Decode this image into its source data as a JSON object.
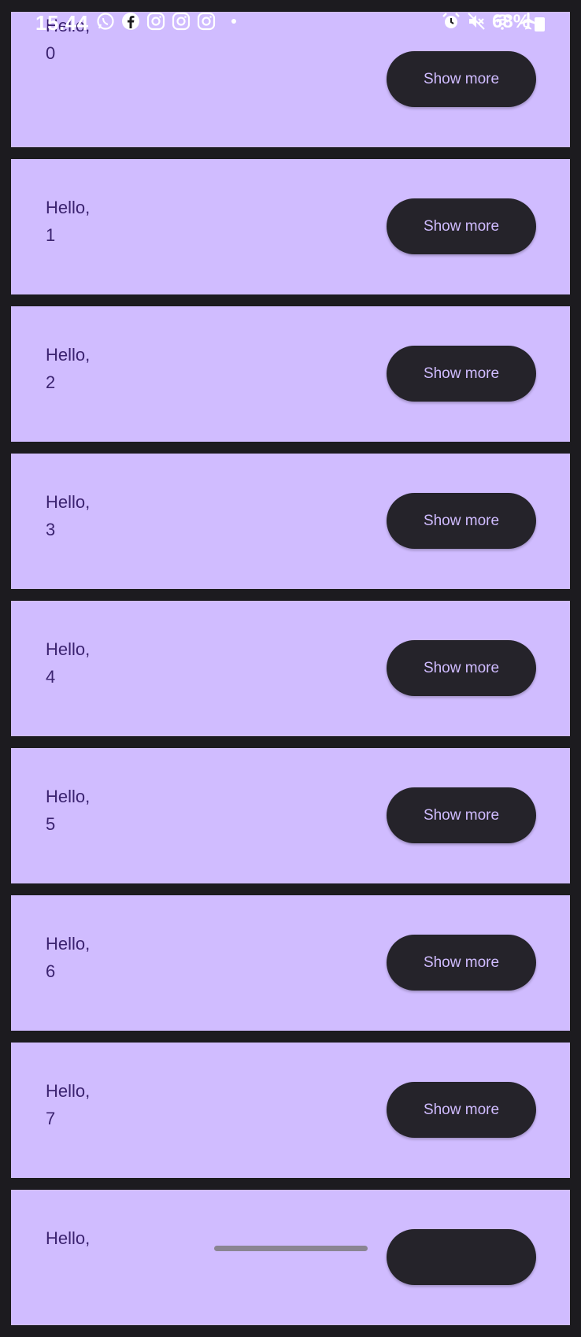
{
  "status_bar": {
    "time": "15.44",
    "battery_percent": "68%",
    "left_icons": [
      "whatsapp-icon",
      "facebook-icon",
      "instagram-icon",
      "instagram-icon",
      "instagram-icon"
    ],
    "right_icons": [
      "alarm-icon",
      "mute-icon",
      "wifi-icon",
      "airplane-icon"
    ]
  },
  "colors": {
    "background": "#1c1b1f",
    "card": "#d0bcff",
    "card_text": "#3b2370",
    "button": "#25232a",
    "button_text": "#d0bcff"
  },
  "cards": [
    {
      "greeting": "Hello,",
      "number": "0",
      "button_label": "Show more"
    },
    {
      "greeting": "Hello,",
      "number": "1",
      "button_label": "Show more"
    },
    {
      "greeting": "Hello,",
      "number": "2",
      "button_label": "Show more"
    },
    {
      "greeting": "Hello,",
      "number": "3",
      "button_label": "Show more"
    },
    {
      "greeting": "Hello,",
      "number": "4",
      "button_label": "Show more"
    },
    {
      "greeting": "Hello,",
      "number": "5",
      "button_label": "Show more"
    },
    {
      "greeting": "Hello,",
      "number": "6",
      "button_label": "Show more"
    },
    {
      "greeting": "Hello,",
      "number": "7",
      "button_label": "Show more"
    },
    {
      "greeting": "Hello,",
      "number": "",
      "button_label": ""
    }
  ]
}
